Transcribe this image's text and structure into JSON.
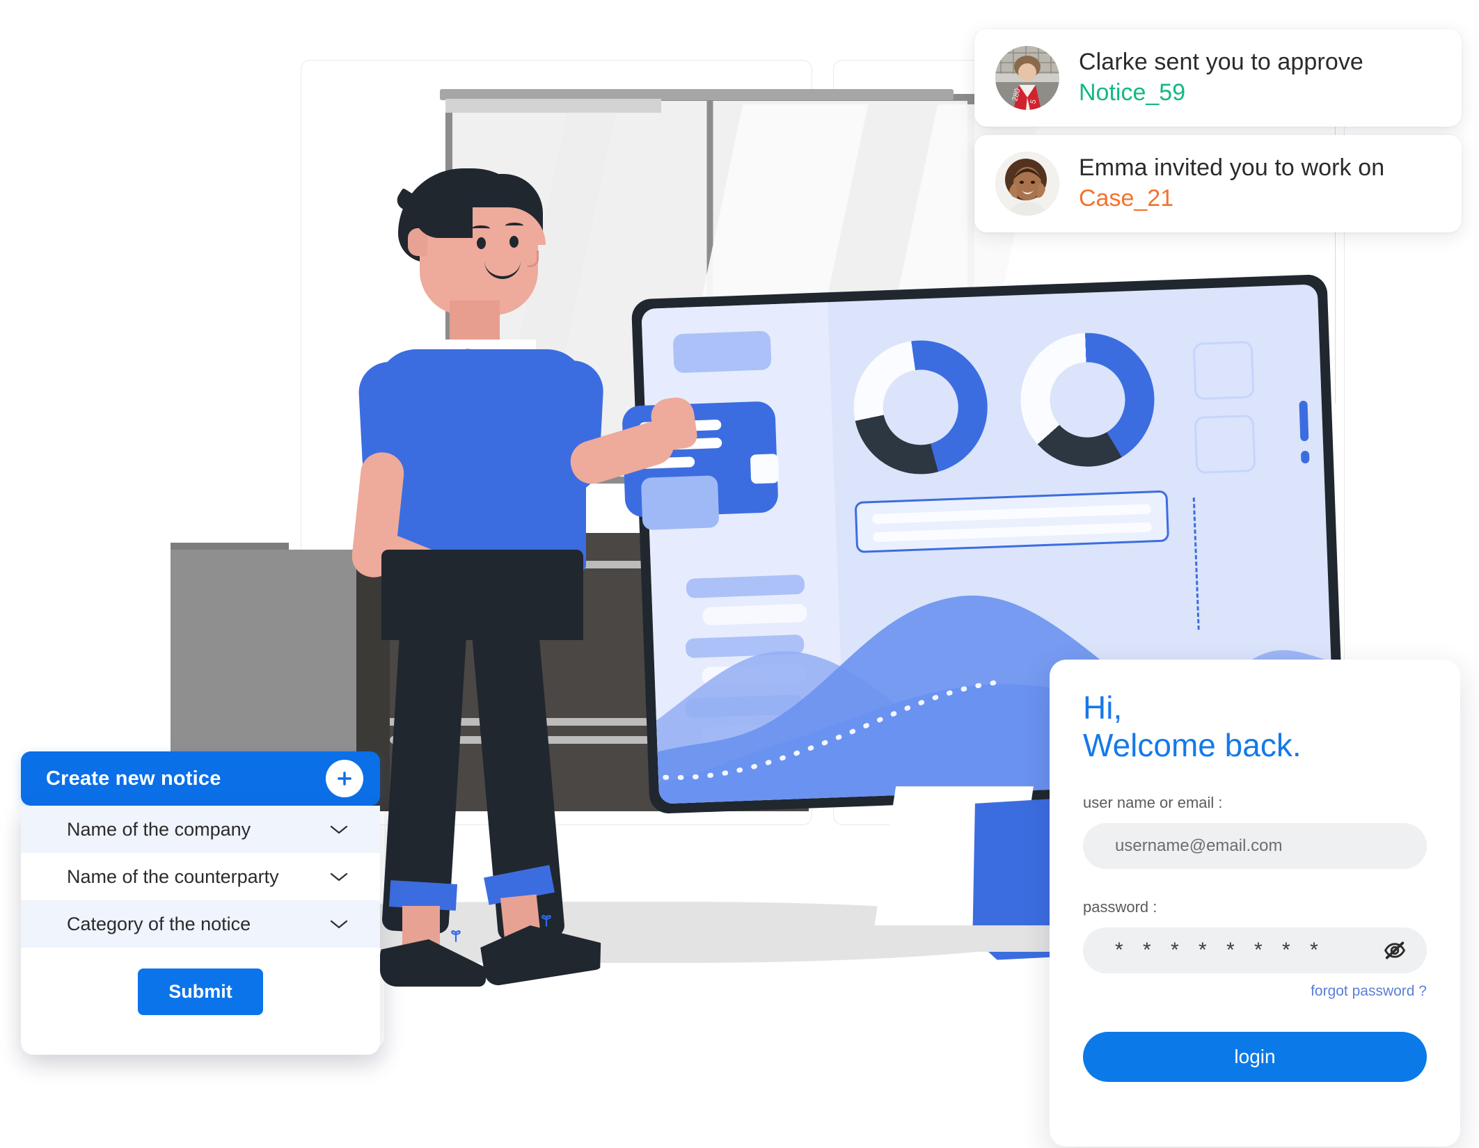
{
  "notifications": [
    {
      "avatar_name": "person-curly-hair-red-jacket",
      "message": "Clarke sent you to approve",
      "link": "Notice_59",
      "link_color": "#12b886"
    },
    {
      "avatar_name": "smiling-woman-hands-on-face",
      "message": "Emma invited you to work on",
      "link": "Case_21",
      "link_color": "#f4722b"
    }
  ],
  "notice_form": {
    "title": "Create new notice",
    "add_icon": "plus-icon",
    "rows": [
      {
        "label": "Name of the company",
        "icon": "chevron-down-icon"
      },
      {
        "label": "Name of the counterparty",
        "icon": "chevron-down-icon"
      },
      {
        "label": "Category of the notice",
        "icon": "chevron-down-icon"
      }
    ],
    "submit_label": "Submit",
    "header_color": "#0b6fe8",
    "submit_color": "#0b74ea"
  },
  "login": {
    "greeting": "Hi,",
    "welcome": "Welcome back.",
    "username_label": "user name or email :",
    "username_placeholder": "username@email.com",
    "username_value": "",
    "password_label": "password :",
    "password_masked": "* * * * * * * *",
    "password_toggle_icon": "eye-off-icon",
    "forgot_label": "forgot password ?",
    "login_label": "login",
    "accent_color": "#1579ea",
    "button_color": "#0b7ae8"
  },
  "illustration": {
    "scene_name": "man-standing-beside-desktop-monitor",
    "accent_blue": "#3c6de0",
    "dark": "#20272f",
    "screen_bg": "#dbe4fb",
    "donuts": [
      {
        "name": "donut-chart-left",
        "segments": [
          {
            "color": "#3c6de0",
            "pct": 48
          },
          {
            "color": "#2d3742",
            "pct": 26
          },
          {
            "color": "#fbfcff",
            "pct": 26
          }
        ]
      },
      {
        "name": "donut-chart-right",
        "segments": [
          {
            "color": "#3c6de0",
            "pct": 42
          },
          {
            "color": "#2d3742",
            "pct": 22
          },
          {
            "color": "#fbfcff",
            "pct": 36
          }
        ]
      }
    ],
    "exclamation_icon": "exclamation-mark-icon"
  }
}
